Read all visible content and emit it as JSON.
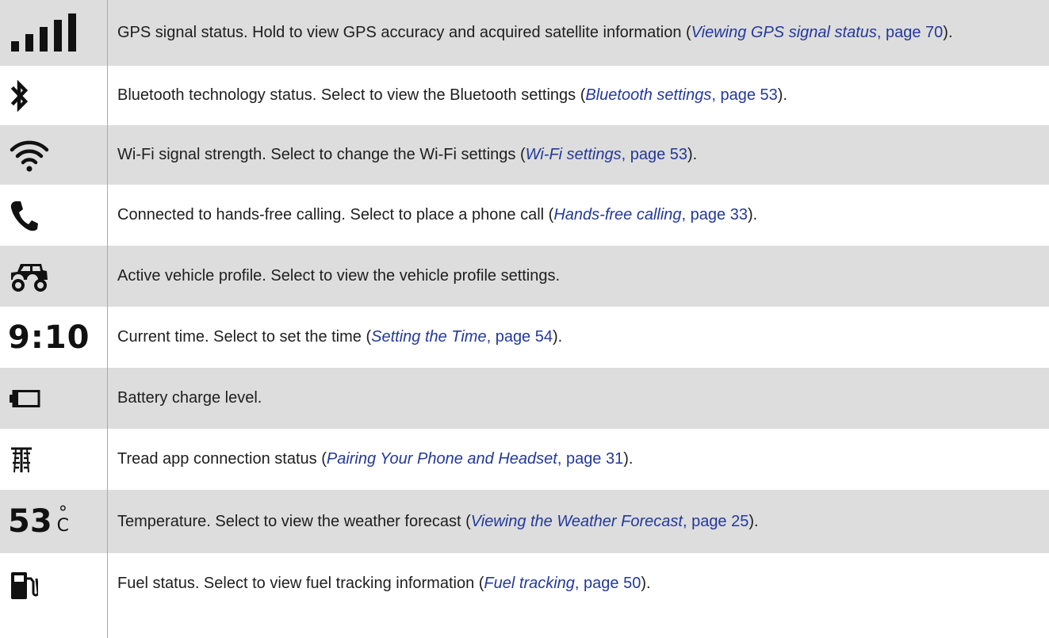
{
  "rows": [
    {
      "icon": "gps-signal-icon",
      "text_before": "GPS signal status. Hold to view GPS accuracy and acquired satellite information (",
      "link_title": "Viewing GPS signal status",
      "link_page": ", page 70",
      "text_after": ")."
    },
    {
      "icon": "bluetooth-icon",
      "text_before": "Bluetooth technology status. Select to view the Bluetooth settings (",
      "link_title": "Bluetooth settings",
      "link_page": ", page 53",
      "text_after": ")."
    },
    {
      "icon": "wifi-icon",
      "text_before": "Wi-Fi signal strength. Select to change the Wi-Fi settings (",
      "link_title": "Wi-Fi settings",
      "link_page": ", page 53",
      "text_after": ")."
    },
    {
      "icon": "phone-icon",
      "text_before": "Connected to hands-free calling. Select to place a phone call (",
      "link_title": "Hands-free calling",
      "link_page": ", page 33",
      "text_after": ")."
    },
    {
      "icon": "off-road-vehicle-icon",
      "text_before": "Active vehicle profile. Select to view the vehicle profile settings."
    },
    {
      "icon_text": "9:10",
      "text_before": "Current time. Select to set the time (",
      "link_title": "Setting the Time",
      "link_page": ", page 54",
      "text_after": ")."
    },
    {
      "icon": "battery-icon",
      "text_before": "Battery charge level."
    },
    {
      "icon": "tread-app-icon",
      "text_before": "Tread app connection status (",
      "link_title": "Pairing Your Phone and Headset",
      "link_page": ", page 31",
      "text_after": ")."
    },
    {
      "icon_text": "53",
      "icon_unit_top": "°",
      "icon_unit_bottom": "C",
      "text_before": "Temperature. Select to view the weather forecast (",
      "link_title": "Viewing the Weather Forecast",
      "link_page": ", page 25",
      "text_after": ")."
    },
    {
      "icon": "fuel-pump-icon",
      "text_before": "Fuel status. Select to view fuel tracking information (",
      "link_title": "Fuel tracking",
      "link_page": ", page 50",
      "text_after": ")."
    }
  ],
  "colors": {
    "shaded_row": "#dddddd",
    "link": "#23399a",
    "text": "#1e1e1e",
    "divider": "#a9a9a9"
  }
}
